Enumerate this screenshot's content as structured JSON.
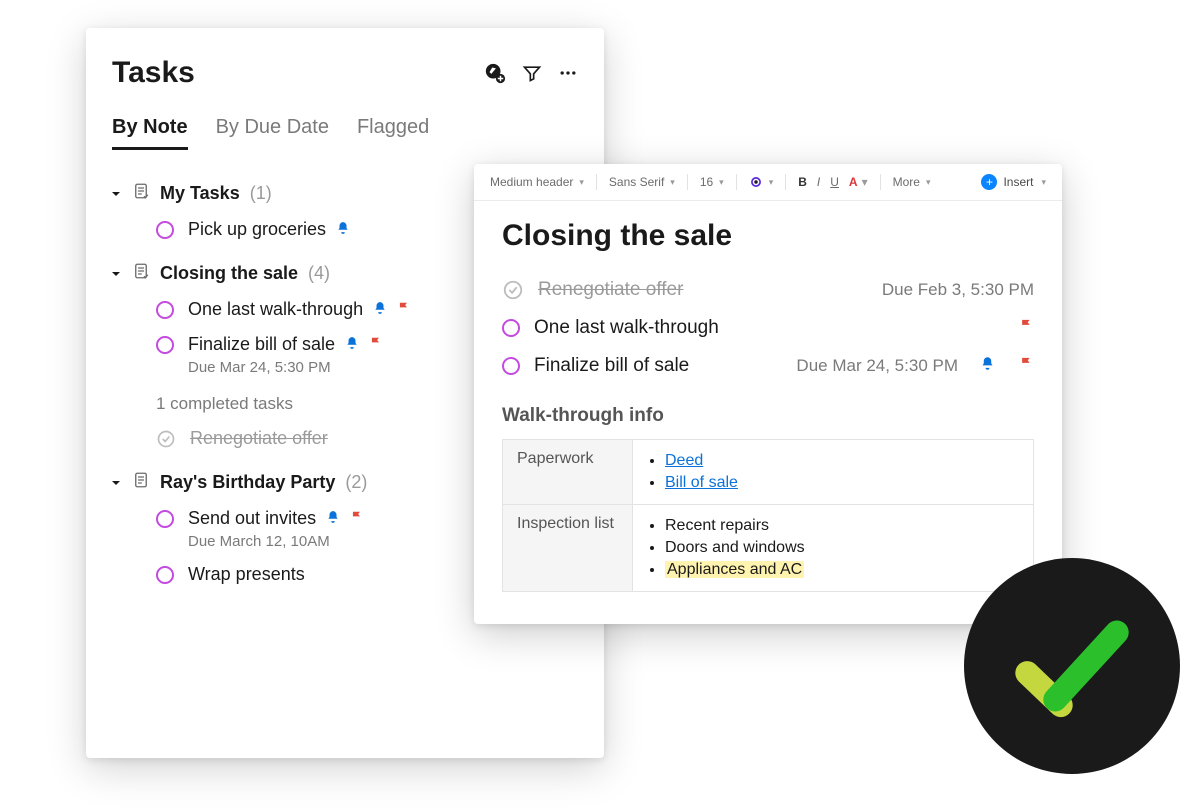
{
  "tasks_panel": {
    "title": "Tasks",
    "tabs": [
      "By Note",
      "By Due Date",
      "Flagged"
    ],
    "active_tab": 0,
    "groups": [
      {
        "name": "My Tasks",
        "count": "(1)",
        "tasks": [
          {
            "title": "Pick up groceries",
            "reminder": true,
            "flag": false,
            "due": null
          }
        ],
        "completed_label": null,
        "completed": []
      },
      {
        "name": "Closing the sale",
        "count": "(4)",
        "tasks": [
          {
            "title": "One last walk-through",
            "reminder": true,
            "flag": true,
            "due": null
          },
          {
            "title": "Finalize bill of sale",
            "reminder": true,
            "flag": true,
            "due": "Due Mar 24, 5:30 PM"
          }
        ],
        "completed_label": "1 completed tasks",
        "completed": [
          {
            "title": "Renegotiate offer"
          }
        ]
      },
      {
        "name": "Ray's Birthday Party",
        "count": "(2)",
        "tasks": [
          {
            "title": "Send out invites",
            "reminder": true,
            "flag": true,
            "due": "Due March 12, 10AM"
          },
          {
            "title": "Wrap presents",
            "reminder": false,
            "flag": false,
            "due": null
          }
        ],
        "completed_label": null,
        "completed": []
      }
    ]
  },
  "note_panel": {
    "toolbar": {
      "style": "Medium header",
      "font": "Sans Serif",
      "size": "16",
      "more": "More",
      "insert": "Insert"
    },
    "title": "Closing the sale",
    "tasks": [
      {
        "title": "Renegotiate offer",
        "completed": true,
        "due": "Due Feb 3, 5:30 PM",
        "reminder": false,
        "flag": false
      },
      {
        "title": "One last walk-through",
        "completed": false,
        "due": null,
        "reminder": false,
        "flag": true
      },
      {
        "title": "Finalize bill of sale",
        "completed": false,
        "due": "Due Mar 24, 5:30 PM",
        "reminder": true,
        "flag": true
      }
    ],
    "section_title": "Walk-through info",
    "table": {
      "rows": [
        {
          "label": "Paperwork",
          "items": [
            {
              "text": "Deed",
              "link": true
            },
            {
              "text": "Bill of sale",
              "link": true
            }
          ]
        },
        {
          "label": "Inspection list",
          "items": [
            {
              "text": "Recent repairs"
            },
            {
              "text": "Doors and windows"
            },
            {
              "text": "Appliances and AC",
              "highlight": true
            }
          ]
        }
      ]
    }
  },
  "colors": {
    "accent_purple": "#c44be0",
    "reminder_blue": "#0b72d9",
    "flag_red": "#e24a3b",
    "badge_bg": "#1a1a1a",
    "check_green": "#2bbf2b",
    "check_lime": "#c4d73f"
  }
}
